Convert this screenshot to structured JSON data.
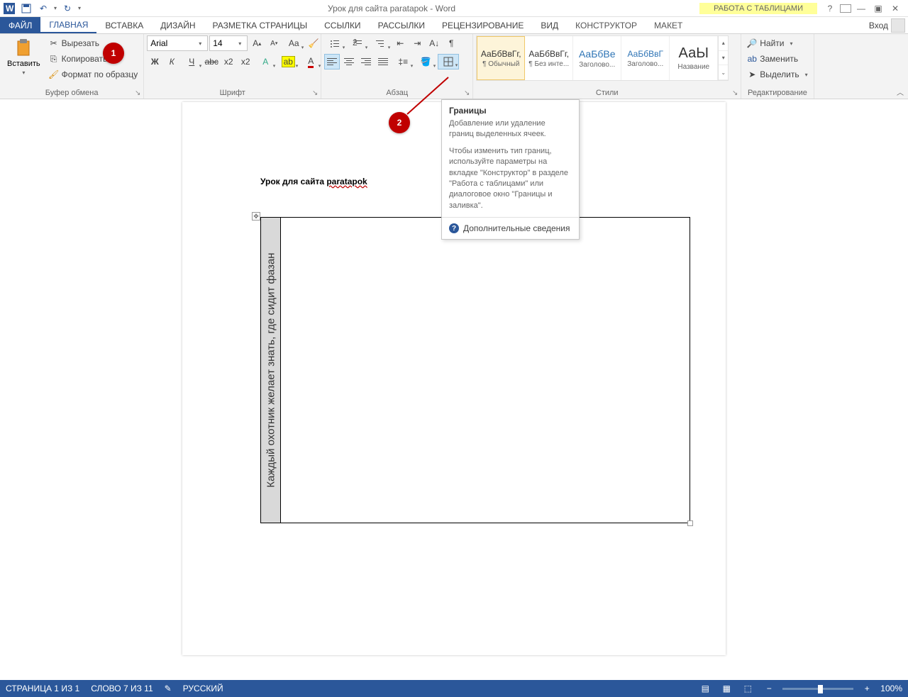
{
  "title": "Урок для сайта paratapok - Word",
  "table_tools_label": "РАБОТА С ТАБЛИЦАМИ",
  "tabs": {
    "file": "ФАЙЛ",
    "home": "ГЛАВНАЯ",
    "insert": "ВСТАВКА",
    "design": "ДИЗАЙН",
    "layout": "РАЗМЕТКА СТРАНИЦЫ",
    "references": "ССЫЛКИ",
    "mailings": "РАССЫЛКИ",
    "review": "РЕЦЕНЗИРОВАНИЕ",
    "view": "ВИД",
    "constructor": "КОНСТРУКТОР",
    "tlayout": "МАКЕТ"
  },
  "signin": "Вход",
  "clipboard": {
    "paste": "Вставить",
    "cut": "Вырезать",
    "copy": "Копировать",
    "format_painter": "Формат по образцу",
    "group_label": "Буфер обмена"
  },
  "font": {
    "name": "Arial",
    "size": "14",
    "group_label": "Шрифт"
  },
  "paragraph": {
    "group_label": "Абзац"
  },
  "styles": {
    "group_label": "Стили",
    "items": [
      {
        "preview": "АаБбВвГг,",
        "label": "¶ Обычный",
        "blue": false
      },
      {
        "preview": "АаБбВвГг,",
        "label": "¶ Без инте...",
        "blue": false
      },
      {
        "preview": "АаБбВе",
        "label": "Заголово...",
        "blue": true
      },
      {
        "preview": "АаБбВвГ",
        "label": "Заголово...",
        "blue": true
      },
      {
        "preview": "АаЫ",
        "label": "Название",
        "blue": false
      }
    ]
  },
  "editing": {
    "group_label": "Редактирование",
    "find": "Найти",
    "replace": "Заменить",
    "select": "Выделить"
  },
  "tooltip": {
    "title": "Границы",
    "p1": "Добавление или удаление границ выделенных ячеек.",
    "p2": "Чтобы изменить тип границ, используйте параметры на вкладке \"Конструктор\" в разделе \"Работа с таблицами\" или диалоговое окно \"Границы и заливка\".",
    "more": "Дополнительные сведения"
  },
  "callouts": {
    "one": "1",
    "two": "2"
  },
  "document": {
    "heading_prefix": "Урок для сайта ",
    "heading_link": "paratapok",
    "cell_text": "Каждый охотник желает знать, где сидит фазан"
  },
  "status": {
    "page": "СТРАНИЦА 1 ИЗ 1",
    "words": "СЛОВО 7 ИЗ 11",
    "lang": "РУССКИЙ",
    "zoom": "100%"
  }
}
